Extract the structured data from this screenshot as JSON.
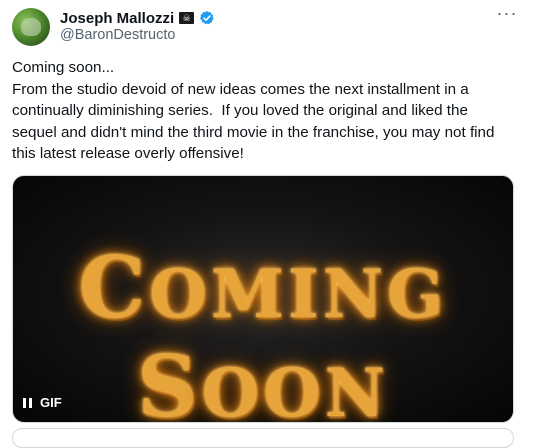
{
  "author": {
    "name": "Joseph Mallozzi",
    "handle": "@BaronDestructo",
    "flag_glyph": "☠",
    "verified_color": "#1d9bf0"
  },
  "tweet": {
    "lines": [
      "Coming soon...",
      "From the studio devoid of new ideas comes the next installment in a",
      "continually diminishing series.  If you loved the original and liked the",
      "sequel and didn't mind the third movie in the franchise, you may not find",
      "this latest release overly offensive!"
    ]
  },
  "media": {
    "type": "GIF",
    "marquee_words": [
      {
        "first": "C",
        "rest": "OMING"
      },
      {
        "first": "S",
        "rest": "OON"
      }
    ],
    "gif_label": "GIF",
    "accent_color": "#e6a43a"
  },
  "icons": {
    "more": "more-horizontal-icon",
    "pause": "pause-icon"
  }
}
